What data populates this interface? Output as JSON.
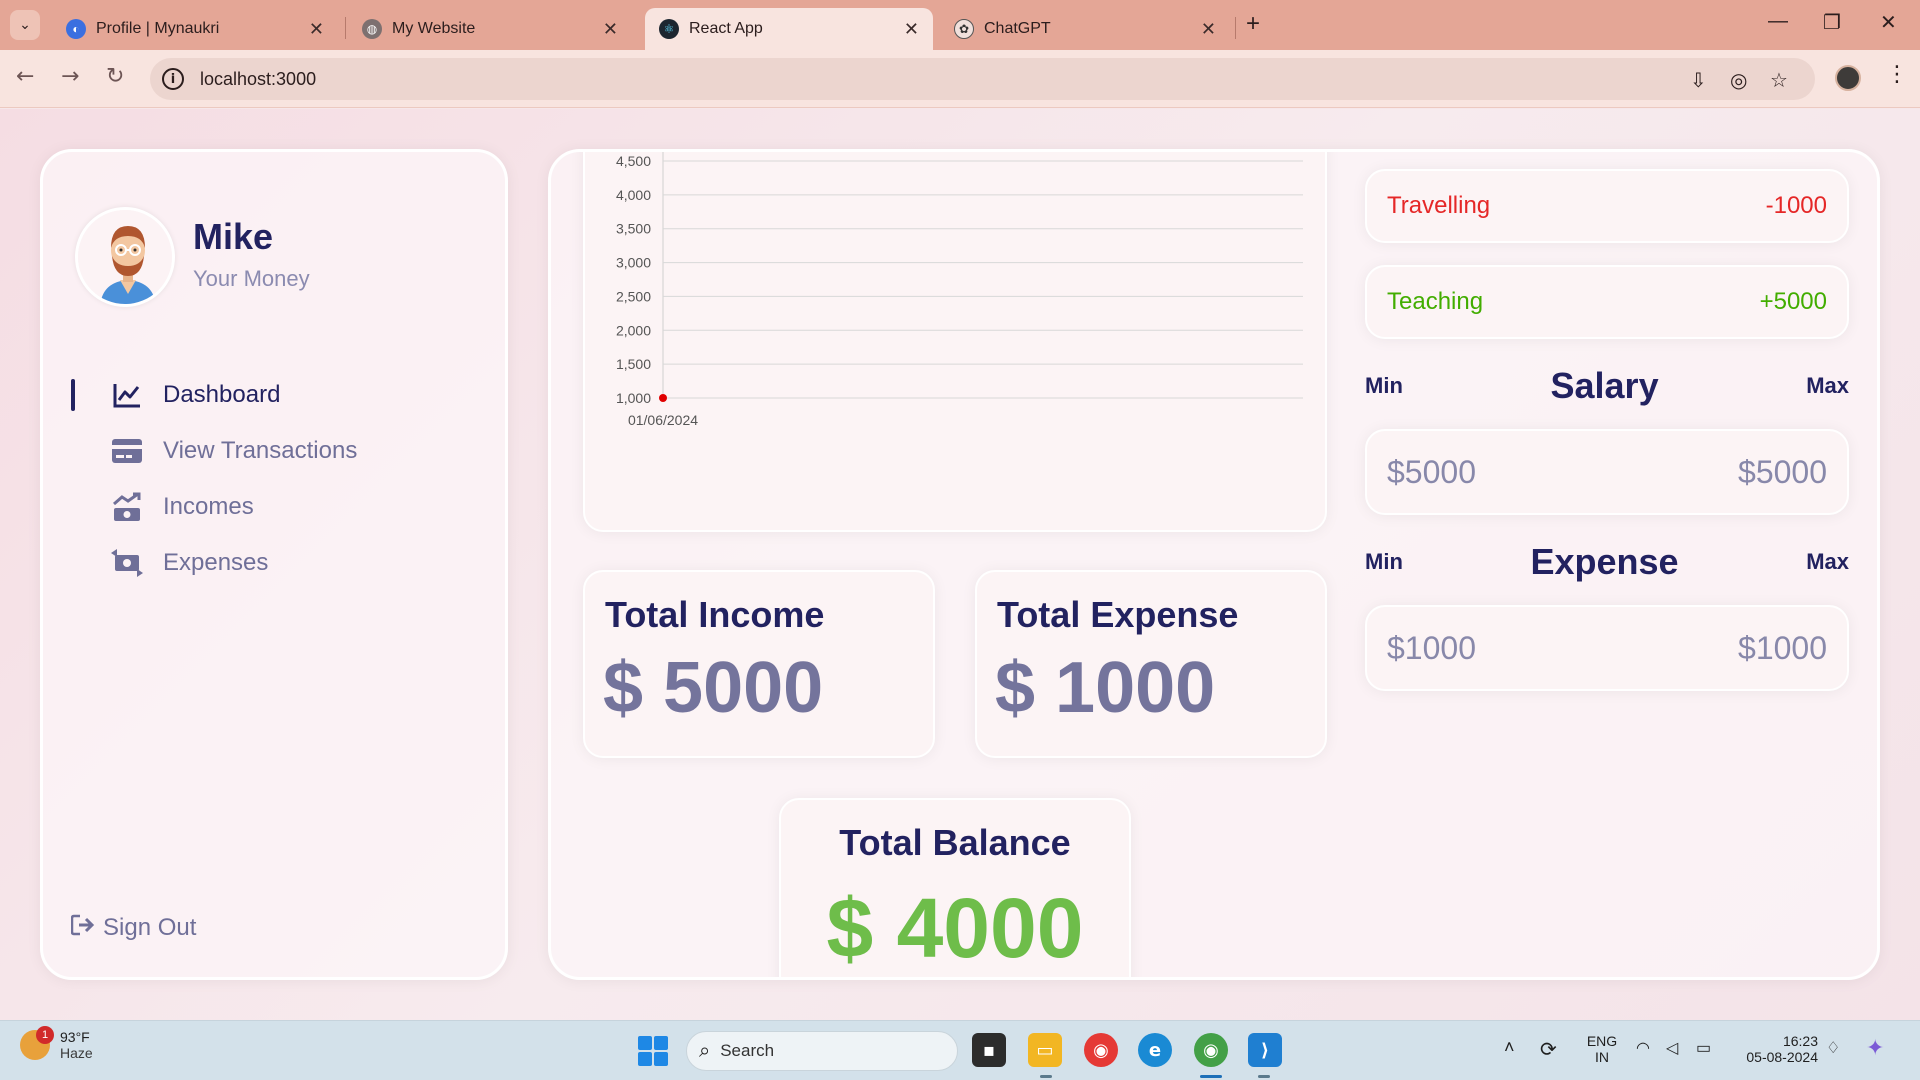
{
  "browser": {
    "tabs": [
      {
        "title": "Profile | Mynaukri",
        "active": false
      },
      {
        "title": "My Website",
        "active": false
      },
      {
        "title": "React App",
        "active": true
      },
      {
        "title": "ChatGPT",
        "active": false
      }
    ],
    "url": "localhost:3000"
  },
  "user": {
    "name": "Mike",
    "subtitle": "Your Money"
  },
  "menu": [
    {
      "label": "Dashboard",
      "icon": "chart-line-icon",
      "active": true
    },
    {
      "label": "View Transactions",
      "icon": "credit-card-icon",
      "active": false
    },
    {
      "label": "Incomes",
      "icon": "money-bill-trend-up-icon",
      "active": false
    },
    {
      "label": "Expenses",
      "icon": "money-bill-transfer-icon",
      "active": false
    }
  ],
  "signout": {
    "label": "Sign Out",
    "icon": "sign-out-icon"
  },
  "chart_data": {
    "type": "line",
    "x": [
      "01/06/2024"
    ],
    "series": [
      {
        "values": [
          1000
        ],
        "color": "#e00000"
      }
    ],
    "y_ticks": [
      "1,000",
      "1,500",
      "2,000",
      "2,500",
      "3,000",
      "3,500",
      "4,000",
      "4,500"
    ],
    "x_tick_labels": [
      "01/06/2024"
    ],
    "ylim": [
      1000,
      4500
    ],
    "grid": true
  },
  "stats": {
    "income": {
      "title": "Total Income",
      "value": "$ 5000"
    },
    "expense": {
      "title": "Total Expense",
      "value": "$ 1000"
    },
    "balance": {
      "title": "Total Balance",
      "value": "$ 4000"
    }
  },
  "history": [
    {
      "title": "Travelling",
      "amount": "-1000",
      "type": "expense"
    },
    {
      "title": "Teaching",
      "amount": "+5000",
      "type": "income"
    }
  ],
  "salary": {
    "min_label": "Min",
    "label": "Salary",
    "max_label": "Max",
    "min": "$5000",
    "max": "$5000"
  },
  "expense_range": {
    "min_label": "Min",
    "label": "Expense",
    "max_label": "Max",
    "min": "$1000",
    "max": "$1000"
  },
  "taskbar": {
    "weather_temp": "93°F",
    "weather_desc": "Haze",
    "weather_badge": "1",
    "search_placeholder": "Search",
    "lang_top": "ENG",
    "lang_bottom": "IN",
    "time": "16:23",
    "date": "05-08-2024"
  },
  "colors": {
    "accent": "#222260",
    "muted": "#74749c",
    "expense": "#e52727",
    "income": "#42ad00",
    "balance": "#6ebd4a"
  }
}
